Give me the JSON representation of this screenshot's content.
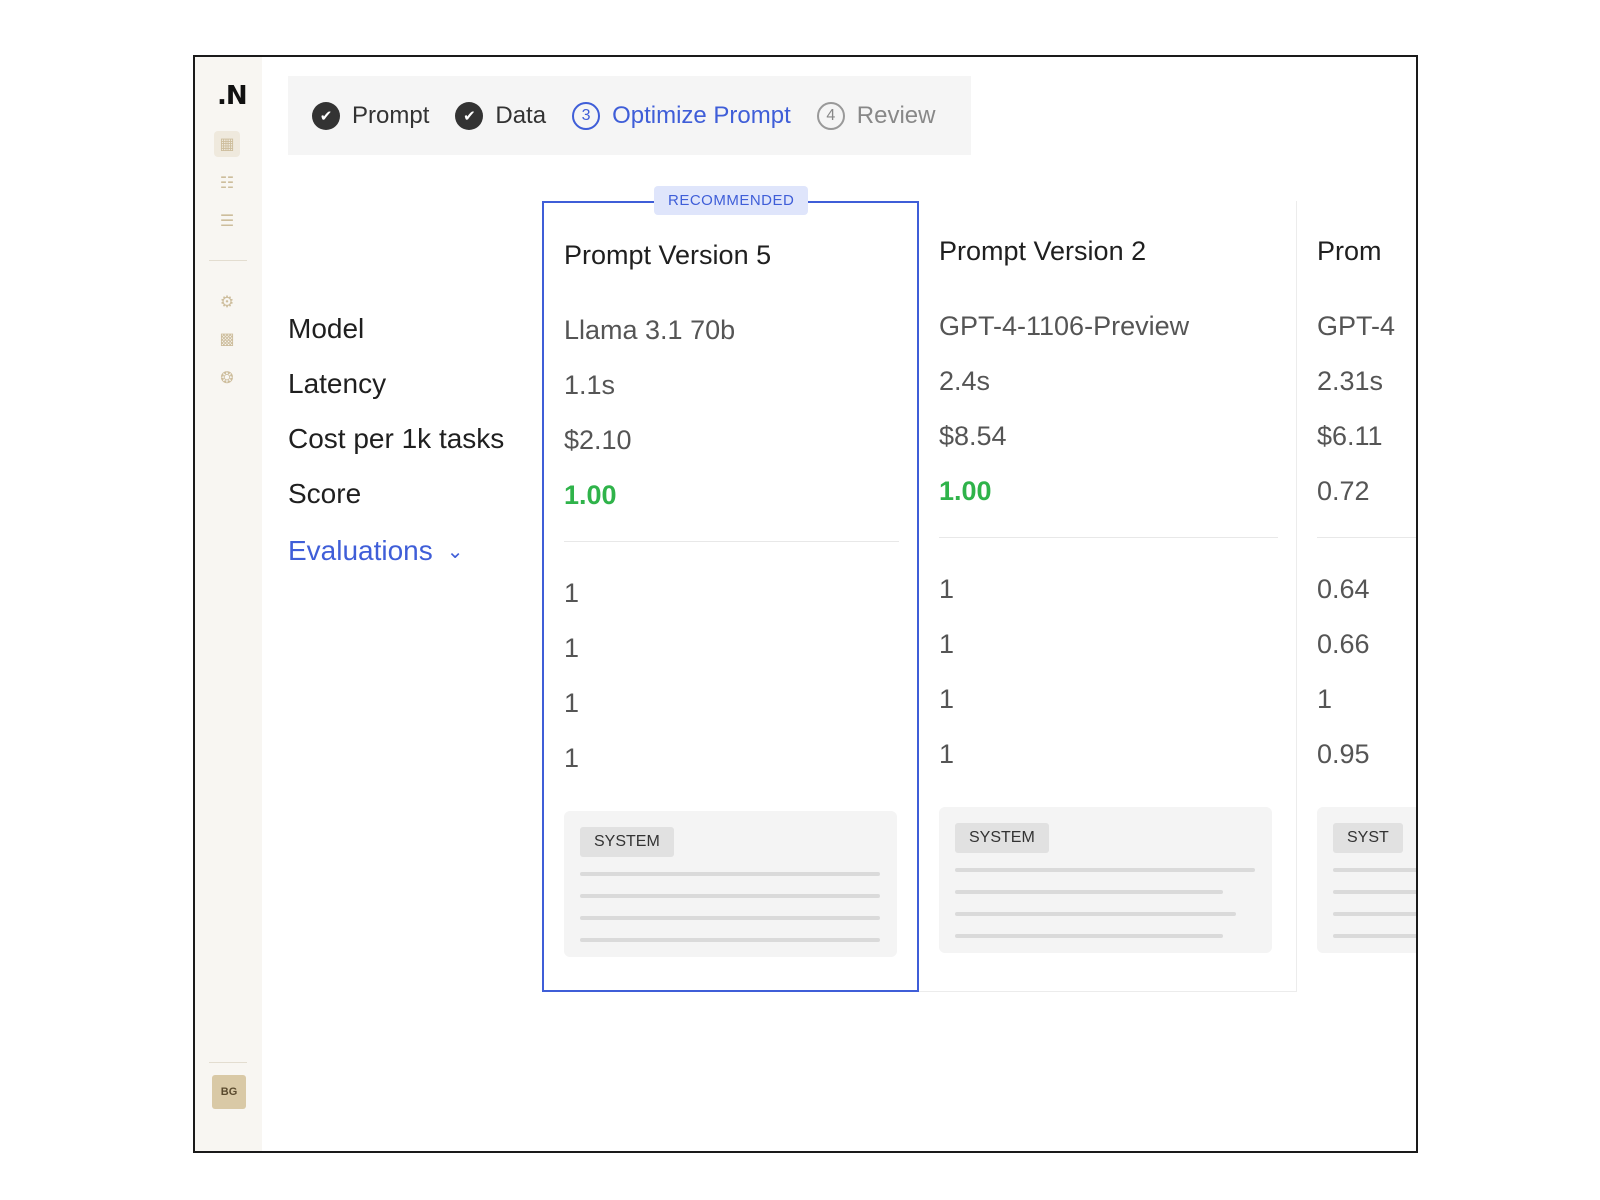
{
  "sidebar": {
    "logo": ".N",
    "icons": [
      "clipboard-icon",
      "sliders-icon",
      "list-icon",
      "gear-icon",
      "book-icon",
      "lifebuoy-icon"
    ],
    "avatar": "BG"
  },
  "stepper": {
    "steps": [
      {
        "num": "✔",
        "label": "Prompt",
        "state": "done"
      },
      {
        "num": "✔",
        "label": "Data",
        "state": "done"
      },
      {
        "num": "3",
        "label": "Optimize Prompt",
        "state": "current"
      },
      {
        "num": "4",
        "label": "Review",
        "state": "todo"
      }
    ]
  },
  "labels": {
    "model": "Model",
    "latency": "Latency",
    "cost": "Cost per 1k tasks",
    "score": "Score",
    "evaluations": "Evaluations"
  },
  "columns": [
    {
      "badge": "RECOMMENDED",
      "title": "Prompt Version 5",
      "model": "Llama 3.1 70b",
      "latency": "1.1s",
      "cost": "$2.10",
      "score": "1.00",
      "evals": [
        "1",
        "1",
        "1",
        "1"
      ],
      "card_tag": "SYSTEM"
    },
    {
      "title": "Prompt Version 2",
      "model": "GPT-4-1106-Preview",
      "latency": "2.4s",
      "cost": "$8.54",
      "score": "1.00",
      "evals": [
        "1",
        "1",
        "1",
        "1"
      ],
      "card_tag": "SYSTEM"
    },
    {
      "title": "Prom",
      "model": "GPT-4",
      "latency": "2.31s",
      "cost": "$6.11",
      "score": "0.72",
      "evals": [
        "0.64",
        "0.66",
        "1",
        "0.95"
      ],
      "card_tag": "SYST"
    }
  ],
  "colors": {
    "accent": "#3f5ed8",
    "score_green": "#2fb34a",
    "sidebar_bg": "#f8f6f2"
  }
}
